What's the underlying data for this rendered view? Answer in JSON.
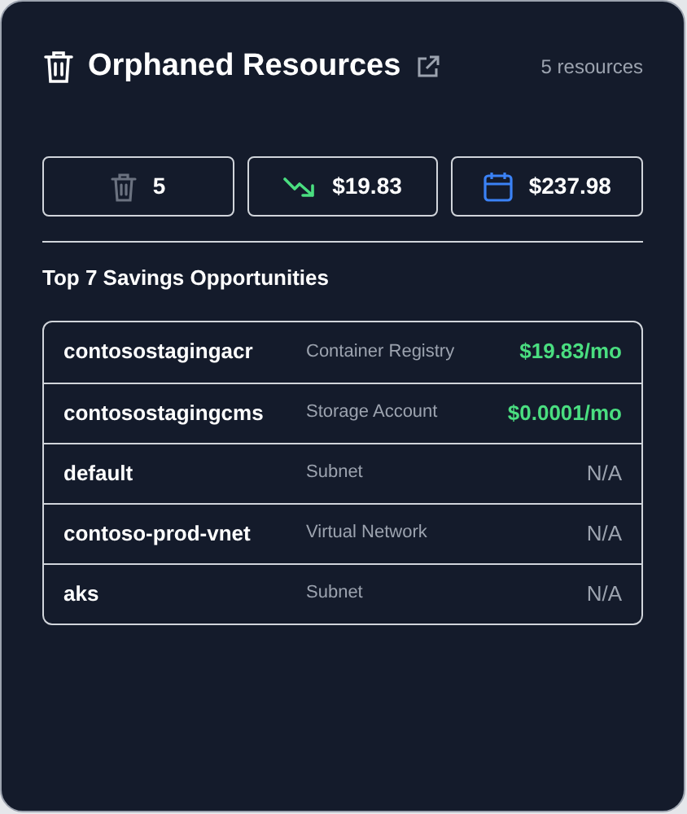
{
  "header": {
    "title": "Orphaned Resources",
    "count": "5 resources"
  },
  "stats": [
    {
      "kind": "count",
      "value": "5"
    },
    {
      "kind": "monthly",
      "value": "$19.83"
    },
    {
      "kind": "yearly",
      "value": "$237.98"
    }
  ],
  "section_title": "Top 7 Savings Opportunities",
  "table": {
    "rows": [
      {
        "name": "contosostagingacr",
        "type": "Container Registry",
        "savings": "$19.83/mo",
        "kind": "saving"
      },
      {
        "name": "contosostagingcms",
        "type": "Storage Account",
        "savings": "$0.0001/mo",
        "kind": "saving"
      },
      {
        "name": "default",
        "type": "Subnet",
        "savings": "N/A",
        "kind": "none"
      },
      {
        "name": "contoso-prod-vnet",
        "type": "Virtual Network",
        "savings": "N/A",
        "kind": "none"
      },
      {
        "name": "aks",
        "type": "Subnet",
        "savings": "N/A",
        "kind": "none"
      }
    ]
  }
}
